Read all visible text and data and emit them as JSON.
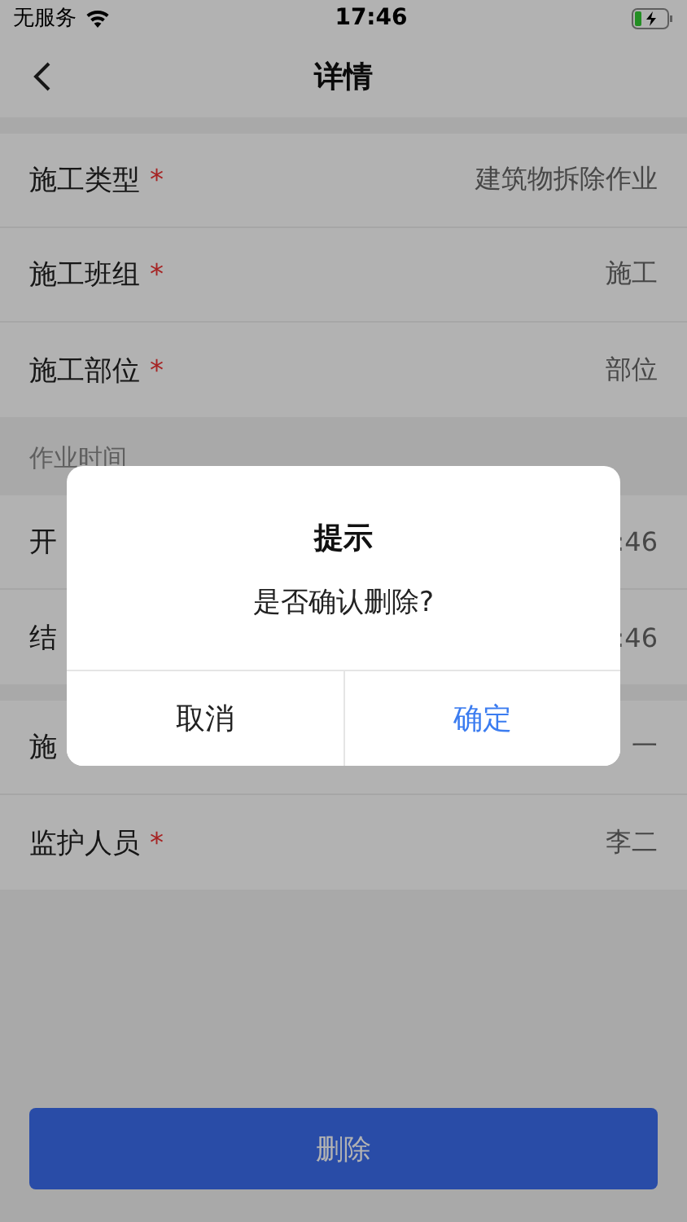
{
  "status_bar": {
    "carrier": "无服务",
    "time": "17:46"
  },
  "nav": {
    "title": "详情"
  },
  "sections": [
    {
      "rows": [
        {
          "label": "施工类型",
          "required_mark": "*",
          "value": "建筑物拆除作业"
        },
        {
          "label": "施工班组",
          "required_mark": "*",
          "value": "施工"
        },
        {
          "label": "施工部位",
          "required_mark": "*",
          "value": "部位"
        }
      ]
    },
    {
      "header": "作业时间",
      "rows": [
        {
          "label": "开",
          "value": ":46"
        },
        {
          "label": "结",
          "value": ":46"
        }
      ]
    },
    {
      "rows": [
        {
          "label": "施",
          "value": "一"
        },
        {
          "label": "监护人员",
          "required_mark": "*",
          "value": "李二"
        }
      ]
    }
  ],
  "delete_button": {
    "label": "删除"
  },
  "dialog": {
    "title": "提示",
    "message": "是否确认删除?",
    "buttons": [
      {
        "label": "取消",
        "kind": "cancel"
      },
      {
        "label": "确定",
        "kind": "confirm"
      }
    ]
  }
}
